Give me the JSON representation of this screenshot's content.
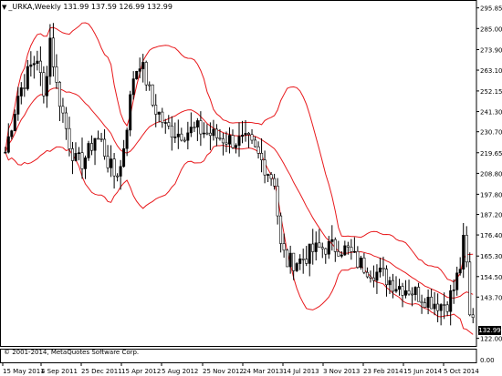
{
  "header": {
    "dropdown_icon": "triangle-down-icon",
    "symbol": "_URKA,Weekly",
    "ohlc": "131.99 137.59 126.99 132.99"
  },
  "copyright": "© 2001-2014, MetaQuotes Software Corp.",
  "current_price": "132.99",
  "colors": {
    "background": "#ffffff",
    "bands": "#e8191c",
    "bull_candle": "#000000",
    "bear_candle": "#ffffff",
    "axis": "#000000"
  },
  "chart_data": {
    "type": "candlestick",
    "indicator": "Bollinger Bands",
    "y_ticks": [
      "295.85",
      "285.00",
      "273.90",
      "263.10",
      "252.15",
      "241.30",
      "230.70",
      "219.65",
      "208.80",
      "197.80",
      "187.20",
      "176.40",
      "165.30",
      "154.50",
      "143.70",
      "132.99",
      "122.00"
    ],
    "ylim": [
      118,
      300
    ],
    "x_labels": [
      "15 May 2011",
      "4 Sep 2011",
      "25 Dec 2011",
      "15 Apr 2012",
      "5 Aug 2012",
      "25 Nov 2012",
      "24 Mar 2013",
      "14 Jul 2013",
      "3 Nov 2013",
      "23 Feb 2014",
      "15 Jun 2014",
      "5 Oct 2014"
    ],
    "sub_window_ticks": [
      "0.00"
    ],
    "close_key_points": [
      [
        0,
        220
      ],
      [
        4,
        250
      ],
      [
        8,
        265
      ],
      [
        10,
        270
      ],
      [
        12,
        248
      ],
      [
        14,
        280
      ],
      [
        16,
        255
      ],
      [
        18,
        240
      ],
      [
        20,
        225
      ],
      [
        22,
        215
      ],
      [
        24,
        215
      ],
      [
        26,
        220
      ],
      [
        28,
        228
      ],
      [
        30,
        225
      ],
      [
        32,
        215
      ],
      [
        34,
        208
      ],
      [
        36,
        212
      ],
      [
        38,
        235
      ],
      [
        40,
        260
      ],
      [
        42,
        268
      ],
      [
        44,
        258
      ],
      [
        46,
        245
      ],
      [
        48,
        240
      ],
      [
        50,
        233
      ],
      [
        54,
        230
      ],
      [
        60,
        232
      ],
      [
        66,
        228
      ],
      [
        71,
        226
      ],
      [
        76,
        225
      ],
      [
        79,
        218
      ],
      [
        82,
        210
      ],
      [
        84,
        205
      ],
      [
        86,
        170
      ],
      [
        88,
        162
      ],
      [
        92,
        163
      ],
      [
        96,
        168
      ],
      [
        100,
        170
      ],
      [
        104,
        170
      ],
      [
        107,
        168
      ],
      [
        110,
        162
      ],
      [
        114,
        158
      ],
      [
        118,
        155
      ],
      [
        122,
        150
      ],
      [
        126,
        148
      ],
      [
        130,
        144
      ],
      [
        134,
        141
      ],
      [
        136,
        140
      ],
      [
        138,
        141
      ],
      [
        140,
        148
      ],
      [
        142,
        160
      ],
      [
        143,
        172
      ],
      [
        144,
        160
      ],
      [
        145,
        133
      ],
      [
        146,
        133
      ]
    ]
  }
}
